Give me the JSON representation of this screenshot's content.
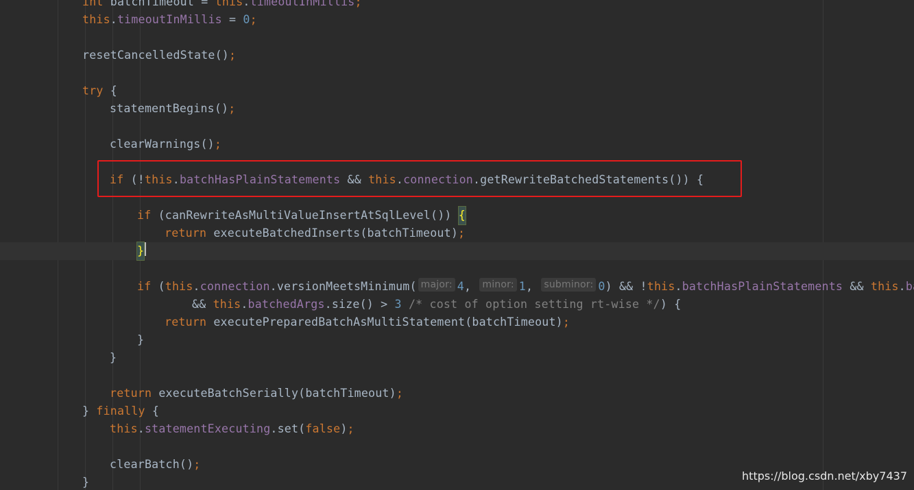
{
  "editor": {
    "language": "java",
    "theme": "darcula",
    "colors": {
      "keyword": "#cc7832",
      "field": "#9876aa",
      "number": "#6897bb",
      "comment": "#808080",
      "text": "#a9b7c6",
      "background": "#2b2b2b",
      "highlight_box": "#e51c1c"
    },
    "lines": [
      [
        {
          "t": "kw",
          "v": "int"
        },
        {
          "t": "plain",
          "v": " batchTimeout = "
        },
        {
          "t": "kw",
          "v": "this"
        },
        {
          "t": "plain",
          "v": "."
        },
        {
          "t": "fld",
          "v": "timeoutInMillis"
        },
        {
          "t": "semi",
          "v": ";"
        }
      ],
      [
        {
          "t": "kw",
          "v": "this"
        },
        {
          "t": "plain",
          "v": "."
        },
        {
          "t": "fld",
          "v": "timeoutInMillis"
        },
        {
          "t": "plain",
          "v": " = "
        },
        {
          "t": "num",
          "v": "0"
        },
        {
          "t": "semi",
          "v": ";"
        }
      ],
      [],
      [
        {
          "t": "plain",
          "v": "resetCancelledState()"
        },
        {
          "t": "semi",
          "v": ";"
        }
      ],
      [],
      [
        {
          "t": "kw",
          "v": "try"
        },
        {
          "t": "plain",
          "v": " {"
        }
      ],
      [
        {
          "t": "plain",
          "v": "statementBegins()"
        },
        {
          "t": "semi",
          "v": ";"
        }
      ],
      [],
      [
        {
          "t": "plain",
          "v": "clearWarnings()"
        },
        {
          "t": "semi",
          "v": ";"
        }
      ],
      [],
      [
        {
          "t": "kw",
          "v": "if"
        },
        {
          "t": "plain",
          "v": " (!"
        },
        {
          "t": "kw",
          "v": "this"
        },
        {
          "t": "plain",
          "v": "."
        },
        {
          "t": "fld",
          "v": "batchHasPlainStatements"
        },
        {
          "t": "plain",
          "v": " && "
        },
        {
          "t": "kw",
          "v": "this"
        },
        {
          "t": "plain",
          "v": "."
        },
        {
          "t": "fld",
          "v": "connection"
        },
        {
          "t": "plain",
          "v": ".getRewriteBatchedStatements()) {"
        }
      ],
      [],
      [
        {
          "t": "kw",
          "v": "if"
        },
        {
          "t": "plain",
          "v": " (canRewriteAsMultiValueInsertAtSqlLevel()) "
        },
        {
          "t": "match",
          "v": "{"
        }
      ],
      [
        {
          "t": "kw",
          "v": "return"
        },
        {
          "t": "plain",
          "v": " executeBatchedInserts(batchTimeout)"
        },
        {
          "t": "semi",
          "v": ";"
        }
      ],
      [
        {
          "t": "match",
          "v": "}"
        },
        {
          "t": "caret",
          "v": ""
        }
      ],
      [],
      [
        {
          "t": "kw",
          "v": "if"
        },
        {
          "t": "plain",
          "v": " ("
        },
        {
          "t": "kw",
          "v": "this"
        },
        {
          "t": "plain",
          "v": "."
        },
        {
          "t": "fld",
          "v": "connection"
        },
        {
          "t": "plain",
          "v": ".versionMeetsMinimum("
        },
        {
          "t": "hint",
          "v": "major:"
        },
        {
          "t": "num",
          "v": "4"
        },
        {
          "t": "plain",
          "v": ", "
        },
        {
          "t": "hint",
          "v": "minor:"
        },
        {
          "t": "num",
          "v": "1"
        },
        {
          "t": "plain",
          "v": ", "
        },
        {
          "t": "hint",
          "v": "subminor:"
        },
        {
          "t": "num",
          "v": "0"
        },
        {
          "t": "plain",
          "v": ") && !"
        },
        {
          "t": "kw",
          "v": "this"
        },
        {
          "t": "plain",
          "v": "."
        },
        {
          "t": "fld",
          "v": "batchHasPlainStatements"
        },
        {
          "t": "plain",
          "v": " && "
        },
        {
          "t": "kw",
          "v": "this"
        },
        {
          "t": "plain",
          "v": "."
        },
        {
          "t": "fld",
          "v": "bat"
        }
      ],
      [
        {
          "t": "plain",
          "v": "&& "
        },
        {
          "t": "kw",
          "v": "this"
        },
        {
          "t": "plain",
          "v": "."
        },
        {
          "t": "fld",
          "v": "batchedArgs"
        },
        {
          "t": "plain",
          "v": ".size() > "
        },
        {
          "t": "num",
          "v": "3"
        },
        {
          "t": "plain",
          "v": " "
        },
        {
          "t": "cmt",
          "v": "/* cost of option setting rt-wise */"
        },
        {
          "t": "plain",
          "v": ") {"
        }
      ],
      [
        {
          "t": "kw",
          "v": "return"
        },
        {
          "t": "plain",
          "v": " executePreparedBatchAsMultiStatement(batchTimeout)"
        },
        {
          "t": "semi",
          "v": ";"
        }
      ],
      [
        {
          "t": "plain",
          "v": "}"
        }
      ],
      [
        {
          "t": "plain",
          "v": "}"
        }
      ],
      [],
      [
        {
          "t": "kw",
          "v": "return"
        },
        {
          "t": "plain",
          "v": " executeBatchSerially(batchTimeout)"
        },
        {
          "t": "semi",
          "v": ";"
        }
      ],
      [
        {
          "t": "plain",
          "v": "} "
        },
        {
          "t": "kw",
          "v": "finally"
        },
        {
          "t": "plain",
          "v": " {"
        }
      ],
      [
        {
          "t": "kw",
          "v": "this"
        },
        {
          "t": "plain",
          "v": "."
        },
        {
          "t": "fld",
          "v": "statementExecuting"
        },
        {
          "t": "plain",
          "v": ".set("
        },
        {
          "t": "kw",
          "v": "false"
        },
        {
          "t": "plain",
          "v": ")"
        },
        {
          "t": "semi",
          "v": ";"
        }
      ],
      [],
      [
        {
          "t": "plain",
          "v": "clearBatch()"
        },
        {
          "t": "semi",
          "v": ";"
        }
      ],
      [
        {
          "t": "plain",
          "v": "}"
        }
      ]
    ]
  },
  "watermark": "https://blog.csdn.net/xby7437"
}
